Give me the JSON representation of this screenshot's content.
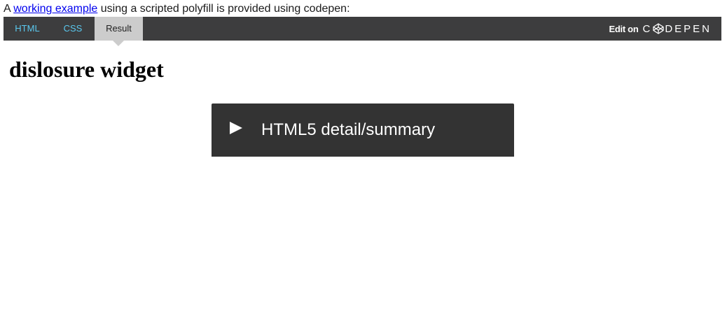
{
  "intro": {
    "prefix": "A ",
    "link_text": "working example",
    "suffix": " using a scripted polyfill is provided using codepen:"
  },
  "codepen": {
    "tabs": [
      {
        "label": "HTML"
      },
      {
        "label": "CSS"
      },
      {
        "label": "Result"
      }
    ],
    "active_tab": "Result",
    "edit_on_label": "Edit on",
    "logo_text": "CODEPEN",
    "logo_letters": {
      "first": "C",
      "rest": "DEPEN"
    },
    "logo_icon": "codepen-cube-icon",
    "colors": {
      "bar_background": "#3d3d3e",
      "tab_text": "#5ac8ee",
      "active_tab_background": "#cccccc"
    }
  },
  "result": {
    "title": "dislosure widget",
    "details": {
      "summary_text": "HTML5 detail/summary",
      "expanded": false,
      "arrow_icon": "triangle-right-icon",
      "background_color": "#333333"
    }
  }
}
